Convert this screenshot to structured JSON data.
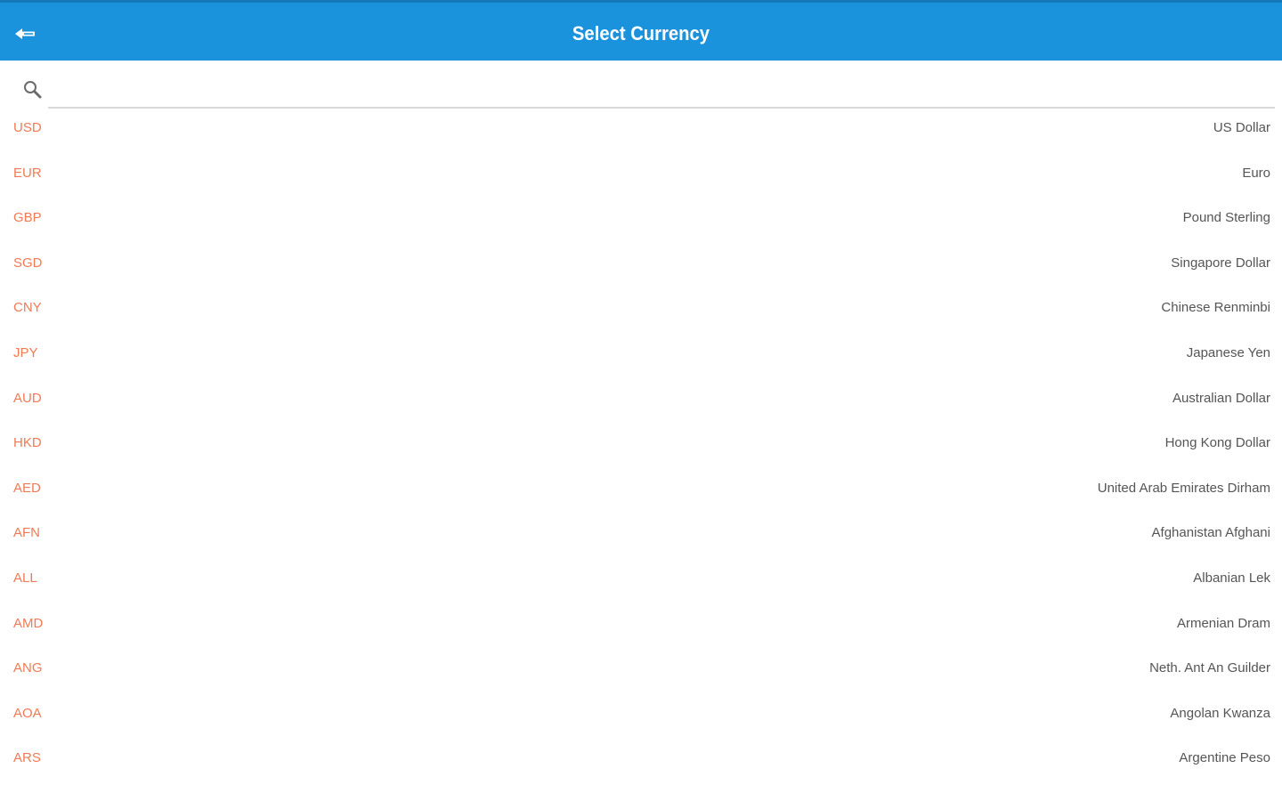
{
  "header": {
    "title": "Select Currency",
    "back_icon": "back-arrow-icon",
    "background_color": "#1a93dc"
  },
  "search": {
    "icon": "search-icon",
    "value": "",
    "placeholder": ""
  },
  "colors": {
    "code": "#f07a55",
    "name": "#555555"
  },
  "currencies": [
    {
      "code": "USD",
      "name": "US Dollar"
    },
    {
      "code": "EUR",
      "name": "Euro"
    },
    {
      "code": "GBP",
      "name": "Pound Sterling"
    },
    {
      "code": "SGD",
      "name": "Singapore Dollar"
    },
    {
      "code": "CNY",
      "name": "Chinese Renminbi"
    },
    {
      "code": "JPY",
      "name": "Japanese Yen"
    },
    {
      "code": "AUD",
      "name": "Australian Dollar"
    },
    {
      "code": "HKD",
      "name": "Hong Kong Dollar"
    },
    {
      "code": "AED",
      "name": "United Arab Emirates Dirham"
    },
    {
      "code": "AFN",
      "name": "Afghanistan Afghani"
    },
    {
      "code": "ALL",
      "name": "Albanian Lek"
    },
    {
      "code": "AMD",
      "name": "Armenian Dram"
    },
    {
      "code": "ANG",
      "name": "Neth. Ant An Guilder"
    },
    {
      "code": "AOA",
      "name": "Angolan Kwanza"
    },
    {
      "code": "ARS",
      "name": "Argentine Peso"
    }
  ]
}
